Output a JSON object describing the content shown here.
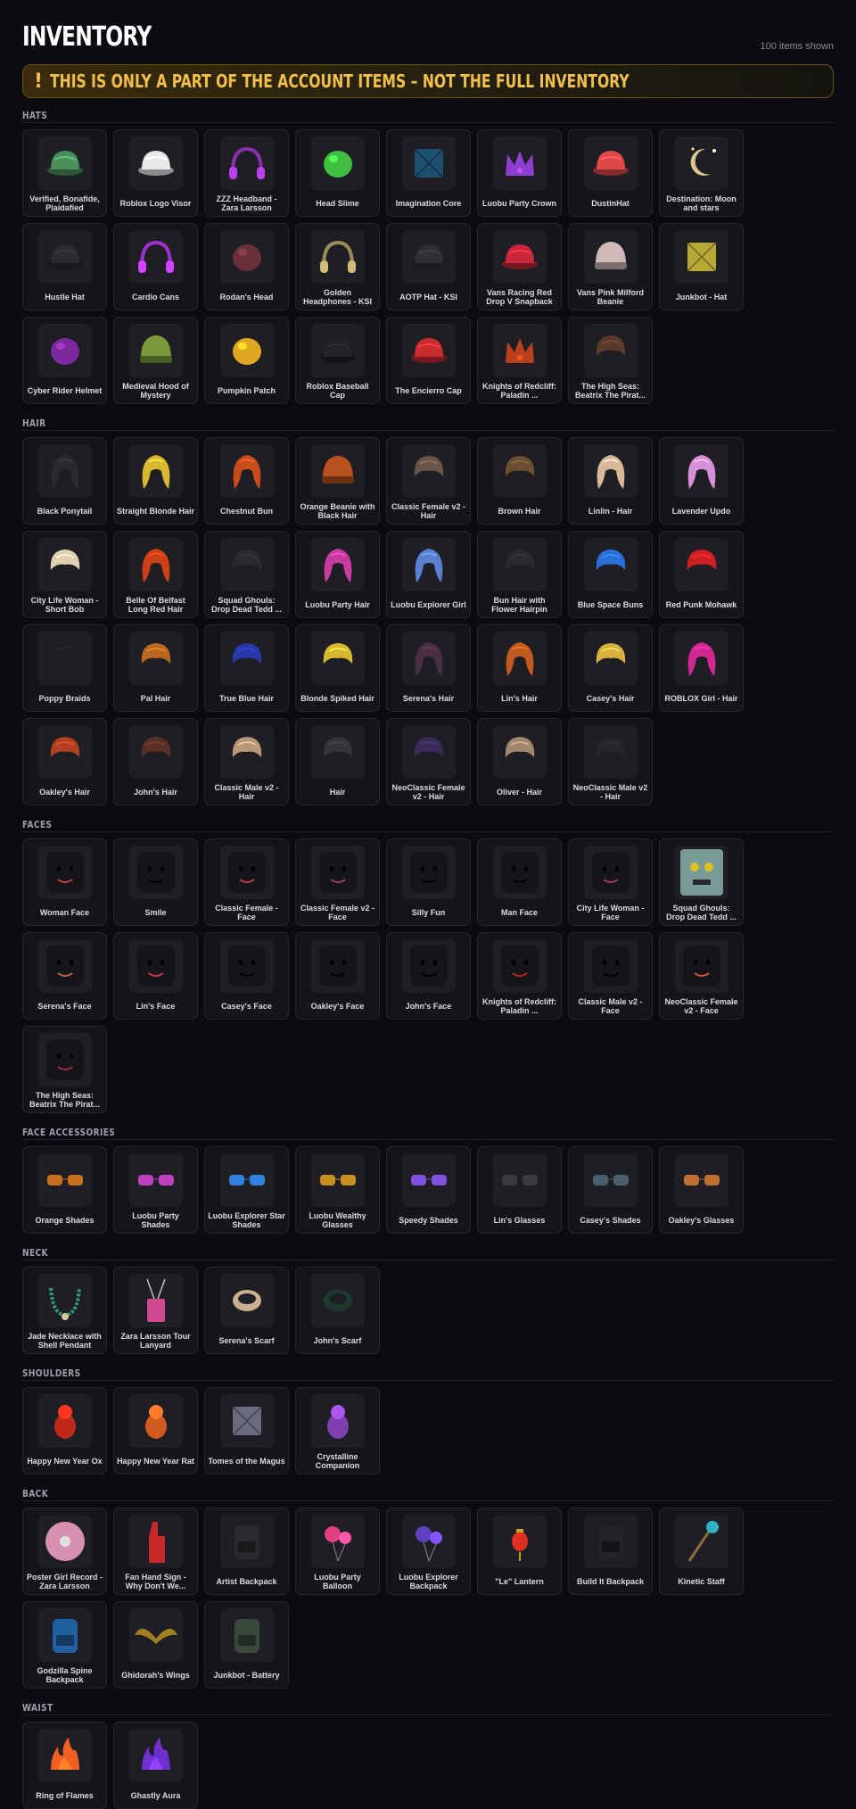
{
  "header": {
    "title": "INVENTORY",
    "count": "100 items shown"
  },
  "warning": {
    "icon": "!",
    "text": "THIS IS ONLY A PART OF THE ACCOUNT ITEMS – NOT THE FULL INVENTORY"
  },
  "sections": [
    {
      "title": "HATS",
      "items": [
        {
          "name": "Verified, Bonafide, Plaidafied",
          "color": "#4a8f5a",
          "shape": "hat"
        },
        {
          "name": "Roblox Logo Visor",
          "color": "#e8e8e8",
          "shape": "hat"
        },
        {
          "name": "ZZZ Headband - Zara Larsson",
          "color": "#8a2fb0",
          "shape": "band"
        },
        {
          "name": "Head Slime",
          "color": "#3fbf3f",
          "shape": "blob"
        },
        {
          "name": "Imagination Core",
          "color": "#1d4f6e",
          "shape": "box"
        },
        {
          "name": "Luobu Party Crown",
          "color": "#8f3fd0",
          "shape": "crown"
        },
        {
          "name": "DustinHat",
          "color": "#e04848",
          "shape": "hat"
        },
        {
          "name": "Destination: Moon and stars",
          "color": "#d8c68a",
          "shape": "moon"
        },
        {
          "name": "Hustle Hat",
          "color": "#2a2a30",
          "shape": "hat"
        },
        {
          "name": "Cardio Cans",
          "color": "#9b32c8",
          "shape": "band"
        },
        {
          "name": "Rodan's Head",
          "color": "#6a3038",
          "shape": "blob"
        },
        {
          "name": "Golden Headphones - KSI",
          "color": "#9a8a5a",
          "shape": "band"
        },
        {
          "name": "AOTP Hat - KSI",
          "color": "#2e2e34",
          "shape": "hat"
        },
        {
          "name": "Vans Racing Red Drop V Snapback",
          "color": "#c8283a",
          "shape": "hat"
        },
        {
          "name": "Vans Pink Milford Beanie",
          "color": "#d0b8b8",
          "shape": "beanie"
        },
        {
          "name": "Junkbot - Hat",
          "color": "#b8a838",
          "shape": "box"
        },
        {
          "name": "Cyber Rider Helmet",
          "color": "#7a2a9a",
          "shape": "blob"
        },
        {
          "name": "Medieval Hood of Mystery",
          "color": "#7a9a3a",
          "shape": "beanie"
        },
        {
          "name": "Pumpkin Patch",
          "color": "#e0a820",
          "shape": "blob"
        },
        {
          "name": "Roblox Baseball Cap",
          "color": "#222228",
          "shape": "hat"
        },
        {
          "name": "The Encierro Cap",
          "color": "#c82c30",
          "shape": "hat"
        },
        {
          "name": "Knights of Redcliff: Paladin ...",
          "color": "#b8401c",
          "shape": "crown"
        },
        {
          "name": "The High Seas: Beatrix The Pirat...",
          "color": "#5a3a2a",
          "shape": "hair"
        }
      ]
    },
    {
      "title": "HAIR",
      "items": [
        {
          "name": "Black Ponytail",
          "color": "#2a2a2e",
          "shape": "long"
        },
        {
          "name": "Straight Blonde Hair",
          "color": "#d8b830",
          "shape": "long"
        },
        {
          "name": "Chestnut Bun",
          "color": "#c84c1c",
          "shape": "long"
        },
        {
          "name": "Orange Beanie with Black Hair",
          "color": "#b85020",
          "shape": "beanie"
        },
        {
          "name": "Classic Female v2 - Hair",
          "color": "#6a5648",
          "shape": "hair"
        },
        {
          "name": "Brown Hair",
          "color": "#6a5030",
          "shape": "hair"
        },
        {
          "name": "Linlin - Hair",
          "color": "#d8b898",
          "shape": "long"
        },
        {
          "name": "Lavender Updo",
          "color": "#d890d8",
          "shape": "long"
        },
        {
          "name": "City Life Woman - Short Bob",
          "color": "#e0d0b0",
          "shape": "hair"
        },
        {
          "name": "Belle Of Belfast Long Red Hair",
          "color": "#d04018",
          "shape": "long"
        },
        {
          "name": "Squad Ghouls: Drop Dead Tedd ...",
          "color": "#2a2a2e",
          "shape": "hair"
        },
        {
          "name": "Luobu Party Hair",
          "color": "#c83ca0",
          "shape": "long"
        },
        {
          "name": "Luobu Explorer Girl",
          "color": "#5a80d0",
          "shape": "long"
        },
        {
          "name": "Bun Hair with Flower Hairpin",
          "color": "#2a2a2e",
          "shape": "hair"
        },
        {
          "name": "Blue Space Buns",
          "color": "#2a70d8",
          "shape": "hair"
        },
        {
          "name": "Red Punk Mohawk",
          "color": "#d02024",
          "shape": "hair"
        },
        {
          "name": "Poppy Braids",
          "color": "#1e1e22",
          "shape": "long"
        },
        {
          "name": "Pal Hair",
          "color": "#b86820",
          "shape": "hair"
        },
        {
          "name": "True Blue Hair",
          "color": "#2838a8",
          "shape": "hair"
        },
        {
          "name": "Blonde Spiked Hair",
          "color": "#d8b830",
          "shape": "hair"
        },
        {
          "name": "Serena's Hair",
          "color": "#4a3040",
          "shape": "long"
        },
        {
          "name": "Lin's Hair",
          "color": "#c05a20",
          "shape": "long"
        },
        {
          "name": "Casey's Hair",
          "color": "#d8b040",
          "shape": "hair"
        },
        {
          "name": "ROBLOX Girl - Hair",
          "color": "#d02890",
          "shape": "long"
        },
        {
          "name": "Oakley's Hair",
          "color": "#b04020",
          "shape": "hair"
        },
        {
          "name": "John's Hair",
          "color": "#5a3024",
          "shape": "hair"
        },
        {
          "name": "Classic Male v2 - Hair",
          "color": "#b89878",
          "shape": "hair"
        },
        {
          "name": "Hair",
          "color": "#34343a",
          "shape": "hair"
        },
        {
          "name": "NeoClassic Female v2 - Hair",
          "color": "#3a2a5a",
          "shape": "hair"
        },
        {
          "name": "Oliver - Hair",
          "color": "#a08870",
          "shape": "hair"
        },
        {
          "name": "NeoClassic Male v2 - Hair",
          "color": "#26262a",
          "shape": "hair"
        }
      ]
    },
    {
      "title": "FACES",
      "items": [
        {
          "name": "Woman Face",
          "color": "#c84050",
          "shape": "face"
        },
        {
          "name": "Smile",
          "color": "#000000",
          "shape": "face"
        },
        {
          "name": "Classic Female - Face",
          "color": "#b84050",
          "shape": "face"
        },
        {
          "name": "Classic Female v2 - Face",
          "color": "#a04050",
          "shape": "face"
        },
        {
          "name": "Silly Fun",
          "color": "#000000",
          "shape": "face"
        },
        {
          "name": "Man Face",
          "color": "#000000",
          "shape": "face"
        },
        {
          "name": "City Life Woman - Face",
          "color": "#a04050",
          "shape": "face"
        },
        {
          "name": "Squad Ghouls: Drop Dead Tedd ...",
          "color": "#7a9a98",
          "shape": "ghoul"
        },
        {
          "name": "Serena's Face",
          "color": "#c86050",
          "shape": "face"
        },
        {
          "name": "Lin's Face",
          "color": "#c84050",
          "shape": "face"
        },
        {
          "name": "Casey's Face",
          "color": "#000000",
          "shape": "face"
        },
        {
          "name": "Oakley's Face",
          "color": "#000000",
          "shape": "face"
        },
        {
          "name": "John's Face",
          "color": "#000000",
          "shape": "face"
        },
        {
          "name": "Knights of Redcliff: Paladin ...",
          "color": "#c02020",
          "shape": "face"
        },
        {
          "name": "Classic Male v2 - Face",
          "color": "#000000",
          "shape": "face"
        },
        {
          "name": "NeoClassic Female v2 - Face",
          "color": "#c86030",
          "shape": "face"
        },
        {
          "name": "The High Seas: Beatrix The Pirat...",
          "color": "#a03040",
          "shape": "face"
        }
      ]
    },
    {
      "title": "FACE ACCESSORIES",
      "items": [
        {
          "name": "Orange Shades",
          "color": "#c87020",
          "shape": "glasses"
        },
        {
          "name": "Luobu Party Shades",
          "color": "#c040c0",
          "shape": "glasses"
        },
        {
          "name": "Luobu Explorer Star Shades",
          "color": "#3080e0",
          "shape": "glasses"
        },
        {
          "name": "Luobu Wealthy Glasses",
          "color": "#c89020",
          "shape": "glasses"
        },
        {
          "name": "Speedy Shades",
          "color": "#8050e0",
          "shape": "glasses"
        },
        {
          "name": "Lin's Glasses",
          "color": "#3a3a40",
          "shape": "glasses"
        },
        {
          "name": "Casey's Shades",
          "color": "#4a6070",
          "shape": "glasses"
        },
        {
          "name": "Oakley's Glasses",
          "color": "#c07030",
          "shape": "glasses"
        }
      ]
    },
    {
      "title": "NECK",
      "items": [
        {
          "name": "Jade Necklace with Shell Pendant",
          "color": "#30a070",
          "shape": "necklace"
        },
        {
          "name": "Zara Larsson Tour Lanyard",
          "color": "#d04890",
          "shape": "lanyard"
        },
        {
          "name": "Serena's Scarf",
          "color": "#c8b090",
          "shape": "scarf"
        },
        {
          "name": "John's Scarf",
          "color": "#1e3a30",
          "shape": "scarf"
        }
      ]
    },
    {
      "title": "SHOULDERS",
      "items": [
        {
          "name": "Happy New Year Ox",
          "color": "#c02818",
          "shape": "pet"
        },
        {
          "name": "Happy New Year Rat",
          "color": "#d05a20",
          "shape": "pet"
        },
        {
          "name": "Tomes of the Magus",
          "color": "#6a6a80",
          "shape": "box"
        },
        {
          "name": "Crystalline Companion",
          "color": "#8040b0",
          "shape": "pet"
        }
      ]
    },
    {
      "title": "BACK",
      "items": [
        {
          "name": "Poster Girl Record - Zara Larsson",
          "color": "#d890b0",
          "shape": "record"
        },
        {
          "name": "Fan Hand Sign - Why Don't We...",
          "color": "#c82828",
          "shape": "hand"
        },
        {
          "name": "Artist Backpack",
          "color": "#2a2a2e",
          "shape": "backpack"
        },
        {
          "name": "Luobu Party Balloon",
          "color": "#e04080",
          "shape": "balloon"
        },
        {
          "name": "Luobu Explorer Backpack",
          "color": "#6040c0",
          "shape": "balloon"
        },
        {
          "name": "\"Le\" Lantern",
          "color": "#e03020",
          "shape": "lantern"
        },
        {
          "name": "Build It Backpack",
          "color": "#222228",
          "shape": "backpack"
        },
        {
          "name": "Kinetic Staff",
          "color": "#30b0c0",
          "shape": "staff"
        },
        {
          "name": "Godzilla Spine Backpack",
          "color": "#2060a0",
          "shape": "backpack"
        },
        {
          "name": "Ghidorah's Wings",
          "color": "#a08020",
          "shape": "wings"
        },
        {
          "name": "Junkbot - Battery",
          "color": "#3a4a3a",
          "shape": "backpack"
        }
      ]
    },
    {
      "title": "WAIST",
      "items": [
        {
          "name": "Ring of Flames",
          "color": "#f06020",
          "shape": "flame"
        },
        {
          "name": "Ghastly Aura",
          "color": "#7030d0",
          "shape": "flame"
        }
      ]
    }
  ]
}
